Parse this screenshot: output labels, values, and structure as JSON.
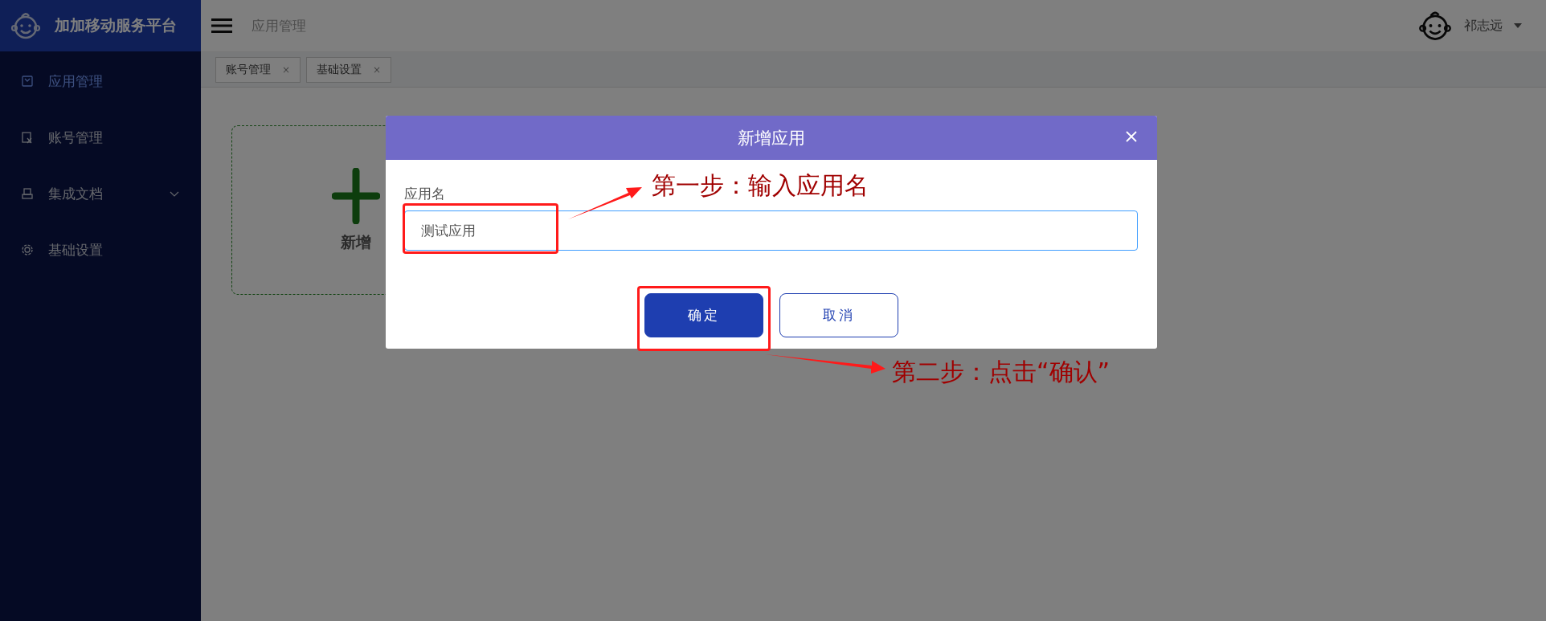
{
  "sidebar": {
    "title": "加加移动服务平台",
    "items": [
      {
        "label": "应用管理",
        "selected": true
      },
      {
        "label": "账号管理",
        "selected": false
      },
      {
        "label": "集成文档",
        "selected": false,
        "expanded": false
      },
      {
        "label": "基础设置",
        "selected": false
      }
    ]
  },
  "header": {
    "title": "应用管理",
    "user": "祁志远"
  },
  "tabs": [
    {
      "label": "账号管理",
      "close": "×"
    },
    {
      "label": "基础设置",
      "close": "×"
    }
  ],
  "card": {
    "label": "新增"
  },
  "dialog": {
    "title": "新增应用",
    "field_label": "应用名",
    "field_value": "测试应用",
    "buttons": [
      {
        "label": "确定",
        "kind": "primary"
      },
      {
        "label": "取消",
        "kind": "secondary"
      }
    ]
  },
  "annotations": [
    {
      "text": "第一步：输入应用名"
    },
    {
      "text": "第二步：点击“确认”"
    }
  ]
}
